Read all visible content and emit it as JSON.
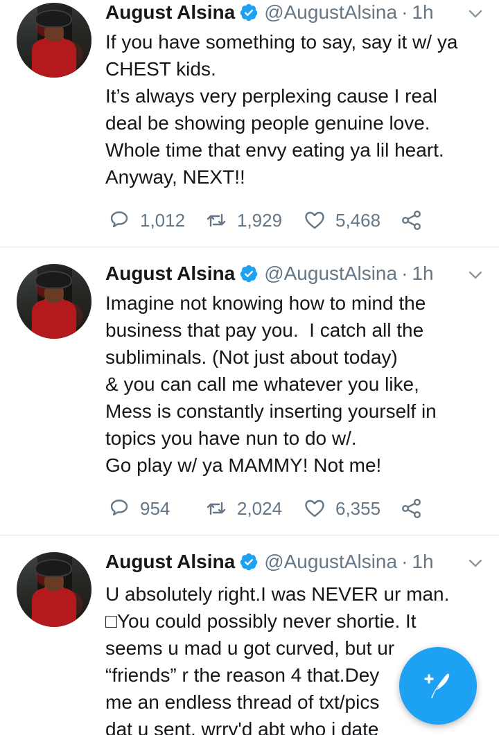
{
  "feed": {
    "tweets": [
      {
        "author": {
          "name": "August Alsina",
          "handle": "@AugustAlsina",
          "time": "1h",
          "verified": true
        },
        "lines": [
          "If you have something to say, say it w/ ya",
          "CHEST kids.",
          "It’s always very perplexing cause I real",
          "deal be showing people genuine love.",
          "Whole time that envy eating ya lil heart.",
          "Anyway, NEXT!!"
        ],
        "stats": {
          "replies": "1,012",
          "retweets": "1,929",
          "likes": "5,468"
        }
      },
      {
        "author": {
          "name": "August Alsina",
          "handle": "@AugustAlsina",
          "time": "1h",
          "verified": true
        },
        "lines": [
          "Imagine not knowing how to mind the",
          "business that pay you.  I catch all the",
          "subliminals. (Not just about today)",
          "& you can call me whatever you like,",
          "Mess is constantly inserting yourself in",
          "topics you have nun to do w/.",
          "Go play w/ ya MAMMY! Not me!"
        ],
        "stats": {
          "replies": "954",
          "retweets": "2,024",
          "likes": "6,355"
        }
      },
      {
        "author": {
          "name": "August Alsina",
          "handle": "@AugustAlsina",
          "time": "1h",
          "verified": true
        },
        "lines": [
          "U absolutely right.I was NEVER ur man.",
          "□You could possibly never shortie. It",
          "seems u mad u got curved, but ur",
          "“friends” r the reason 4 that.Dey",
          "me an endless thread of txt/pics",
          "dat u sent, wrry'd abt who i date"
        ],
        "stats": null
      }
    ]
  },
  "separator": "·",
  "icons": {
    "verified": "verified-badge-icon",
    "caret": "chevron-down-icon",
    "reply": "reply-icon",
    "retweet": "retweet-icon",
    "like": "heart-icon",
    "share": "share-icon",
    "compose": "compose-tweet-icon"
  },
  "colors": {
    "accent": "#1da1f2",
    "text": "#14171a",
    "muted": "#657786",
    "divider": "#e1e8ed"
  }
}
